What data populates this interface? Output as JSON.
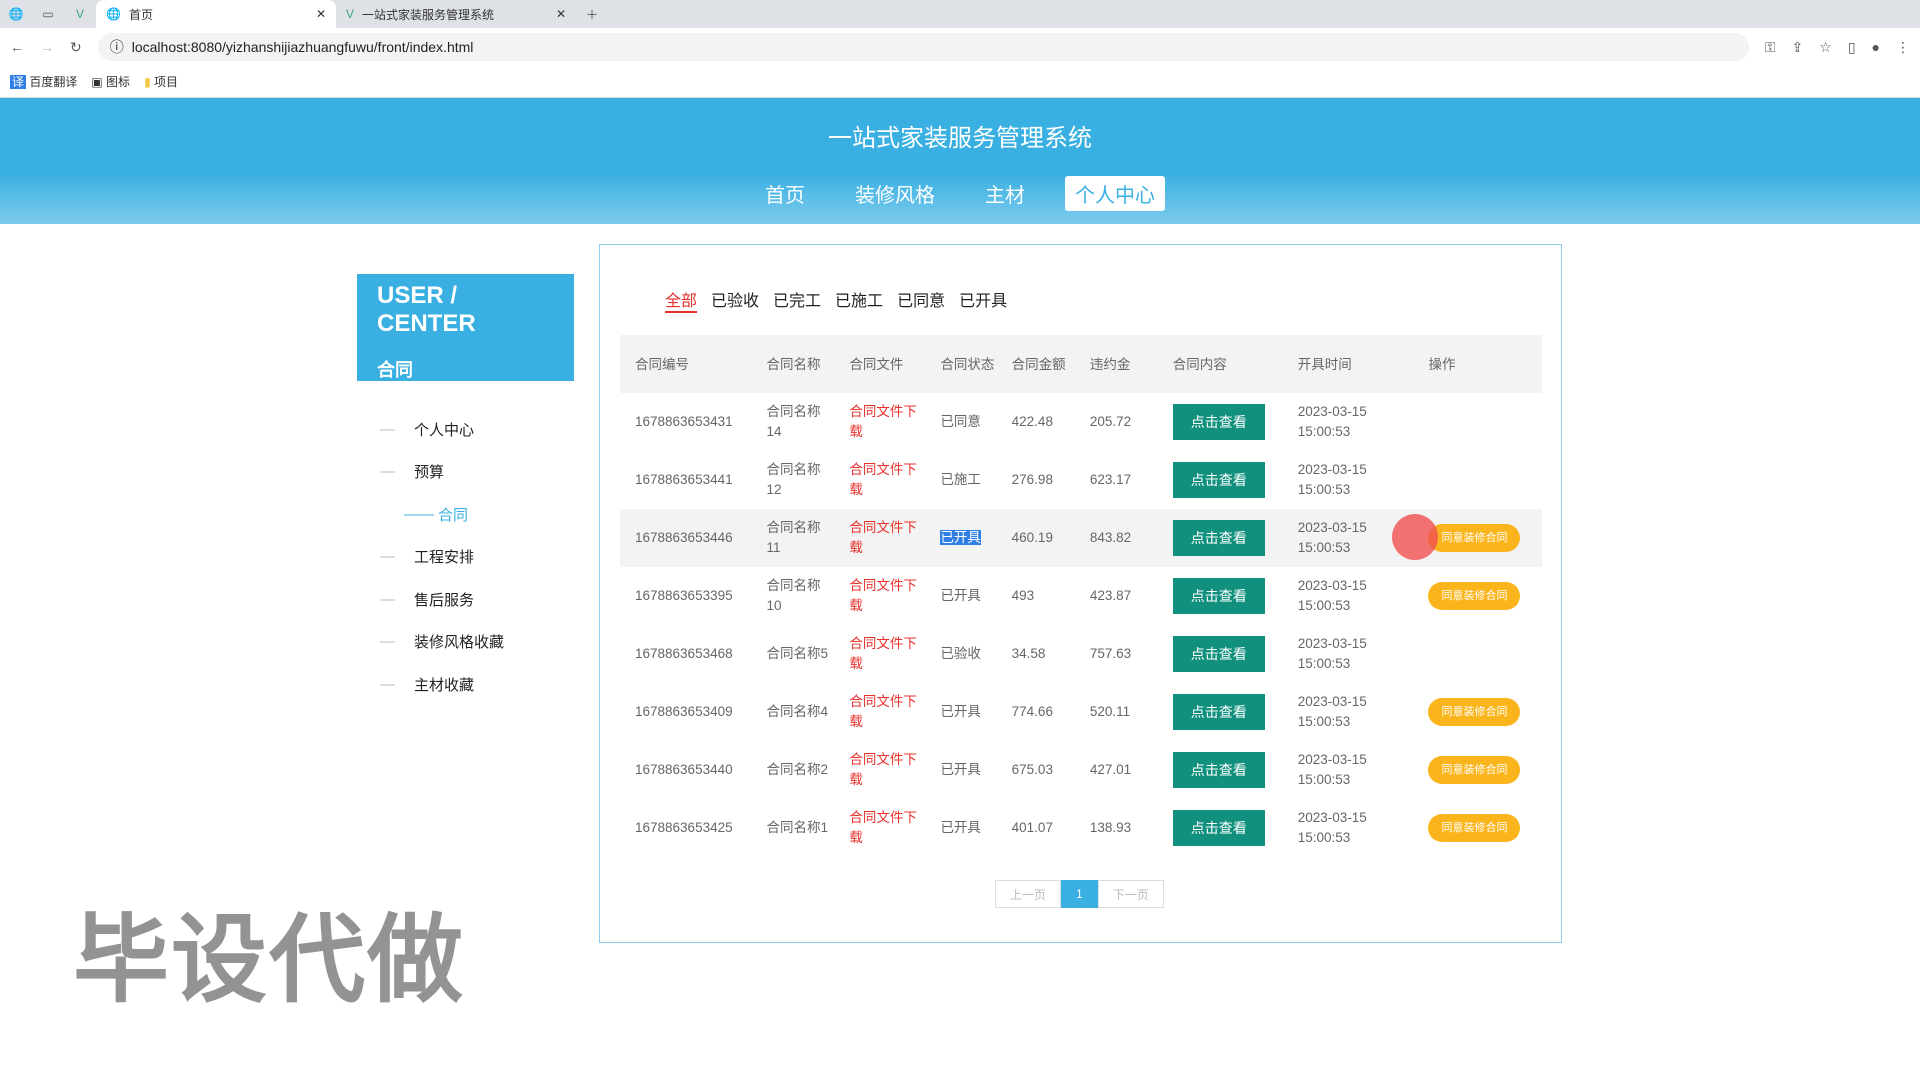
{
  "browser": {
    "tabs": [
      {
        "label": "首页",
        "active": true
      },
      {
        "label": "一站式家装服务管理系统",
        "active": false
      }
    ],
    "url": "localhost:8080/yizhanshijiazhuangfuwu/front/index.html",
    "bookmarks": [
      "百度翻译",
      "图标",
      "项目"
    ]
  },
  "header": {
    "title": "一站式家装服务管理系统",
    "nav": [
      {
        "label": "首页"
      },
      {
        "label": "装修风格"
      },
      {
        "label": "主材"
      },
      {
        "label": "个人中心",
        "active": true
      }
    ]
  },
  "sidebar": {
    "title": "USER / CENTER",
    "subtitle": "合同",
    "items": [
      "个人中心",
      "预算",
      "合同",
      "工程安排",
      "售后服务",
      "装修风格收藏",
      "主材收藏"
    ]
  },
  "filters": [
    "全部",
    "已验收",
    "已完工",
    "已施工",
    "已同意",
    "已开具"
  ],
  "table": {
    "columns": [
      "合同编号",
      "合同名称",
      "合同文件",
      "合同状态",
      "合同金额",
      "违约金",
      "合同内容",
      "开具时间",
      "操作"
    ],
    "rows": [
      [
        "1678863653431",
        "合同名称14",
        "合同文件下载",
        "已同意",
        "422.48",
        "205.72",
        "点击查看",
        "2023-03-15 15:00:53",
        ""
      ],
      [
        "1678863653441",
        "合同名称12",
        "合同文件下载",
        "已施工",
        "276.98",
        "623.17",
        "点击查看",
        "2023-03-15 15:00:53",
        ""
      ],
      [
        "1678863653446",
        "合同名称11",
        "合同文件下载",
        "已开具",
        "460.19",
        "843.82",
        "点击查看",
        "2023-03-15 15:00:53",
        "同意装修合同"
      ],
      [
        "1678863653395",
        "合同名称10",
        "合同文件下载",
        "已开具",
        "493",
        "423.87",
        "点击查看",
        "2023-03-15 15:00:53",
        "同意装修合同"
      ],
      [
        "1678863653468",
        "合同名称5",
        "合同文件下载",
        "已验收",
        "34.58",
        "757.63",
        "点击查看",
        "2023-03-15 15:00:53",
        ""
      ],
      [
        "1678863653409",
        "合同名称4",
        "合同文件下载",
        "已开具",
        "774.66",
        "520.11",
        "点击查看",
        "2023-03-15 15:00:53",
        "同意装修合同"
      ],
      [
        "1678863653440",
        "合同名称2",
        "合同文件下载",
        "已开具",
        "675.03",
        "427.01",
        "点击查看",
        "2023-03-15 15:00:53",
        "同意装修合同"
      ],
      [
        "1678863653425",
        "合同名称1",
        "合同文件下载",
        "已开具",
        "401.07",
        "138.93",
        "点击查看",
        "2023-03-15 15:00:53",
        "同意装修合同"
      ]
    ]
  },
  "pagination": {
    "prev": "上一页",
    "current": "1",
    "next": "下一页"
  },
  "watermark": "毕设代做",
  "colors": {
    "primary": "#3ab0e2",
    "view_button": "#12907e",
    "agree_button": "#fbb51c",
    "active_filter": "#e8312c"
  }
}
